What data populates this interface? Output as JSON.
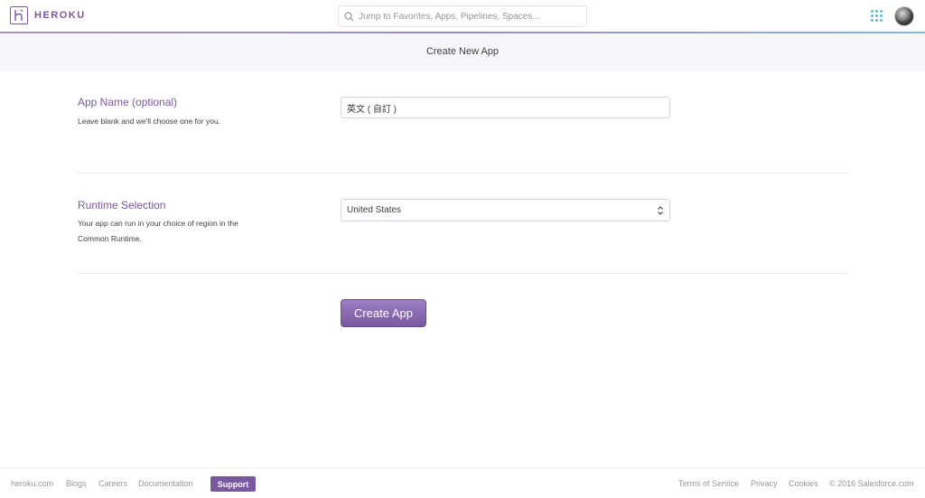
{
  "header": {
    "brand": "HEROKU",
    "search_placeholder": "Jump to Favorites, Apps, Pipelines, Spaces..."
  },
  "subheader": {
    "title": "Create New App"
  },
  "app_name": {
    "title": "App Name (optional)",
    "description": "Leave blank and we'll choose one for you.",
    "value": "英文 ( 自訂 )"
  },
  "runtime": {
    "title": "Runtime Selection",
    "description": "Your app can run in your choice of region in the Common Runtime.",
    "selected": "United States"
  },
  "actions": {
    "create_label": "Create App"
  },
  "footer": {
    "links": [
      "heroku.com",
      "Blogs",
      "Careers",
      "Documentation"
    ],
    "support": "Support",
    "right_links": [
      "Terms of Service",
      "Privacy",
      "Cookies"
    ],
    "copyright": "© 2016 Salesforce.com"
  },
  "colors": {
    "brand_purple": "#79589f",
    "accent_blue": "#6bb3d7"
  }
}
